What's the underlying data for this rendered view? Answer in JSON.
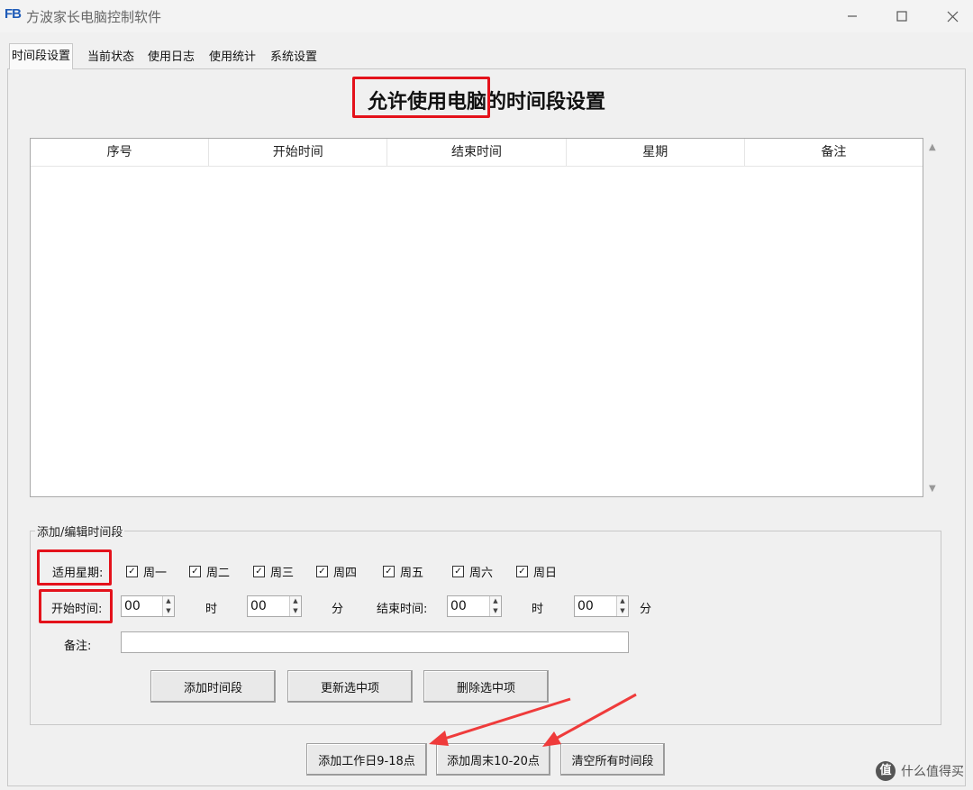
{
  "window": {
    "logo": "FB",
    "title": "方波家长电脑控制软件",
    "minimize_icon": "minimize-icon",
    "maximize_icon": "maximize-icon",
    "close_icon": "close-icon"
  },
  "tabs": [
    {
      "label": "时间段设置",
      "active": true
    },
    {
      "label": "当前状态",
      "active": false
    },
    {
      "label": "使用日志",
      "active": false
    },
    {
      "label": "使用统计",
      "active": false
    },
    {
      "label": "系统设置",
      "active": false
    }
  ],
  "heading": "允许使用电脑的时间段设置",
  "table": {
    "columns": [
      "序号",
      "开始时间",
      "结束时间",
      "星期",
      "备注"
    ],
    "rows": []
  },
  "group": {
    "legend": "添加/编辑时间段",
    "weekday_label": "适用星期:",
    "weekdays": [
      {
        "label": "周一",
        "checked": true
      },
      {
        "label": "周二",
        "checked": true
      },
      {
        "label": "周三",
        "checked": true
      },
      {
        "label": "周四",
        "checked": true
      },
      {
        "label": "周五",
        "checked": true
      },
      {
        "label": "周六",
        "checked": true
      },
      {
        "label": "周日",
        "checked": true
      }
    ],
    "start_label": "开始时间:",
    "start_hour": "00",
    "hour_unit": "时",
    "start_minute": "00",
    "minute_unit": "分",
    "end_label": "结束时间:",
    "end_hour": "00",
    "end_hour_unit": "时",
    "end_minute": "00",
    "end_minute_unit": "分",
    "note_label": "备注:",
    "note_value": "",
    "buttons": {
      "add": "添加时间段",
      "update": "更新选中项",
      "delete": "删除选中项"
    }
  },
  "bottom_buttons": {
    "workday": "添加工作日9-18点",
    "weekend": "添加周末10-20点",
    "clear": "清空所有时间段"
  },
  "watermark": {
    "icon": "值",
    "text": "什么值得买"
  },
  "colors": {
    "highlight_red": "#e4121b",
    "arrow_red": "#ef3b3b",
    "logo_blue": "#1e5bb8"
  }
}
